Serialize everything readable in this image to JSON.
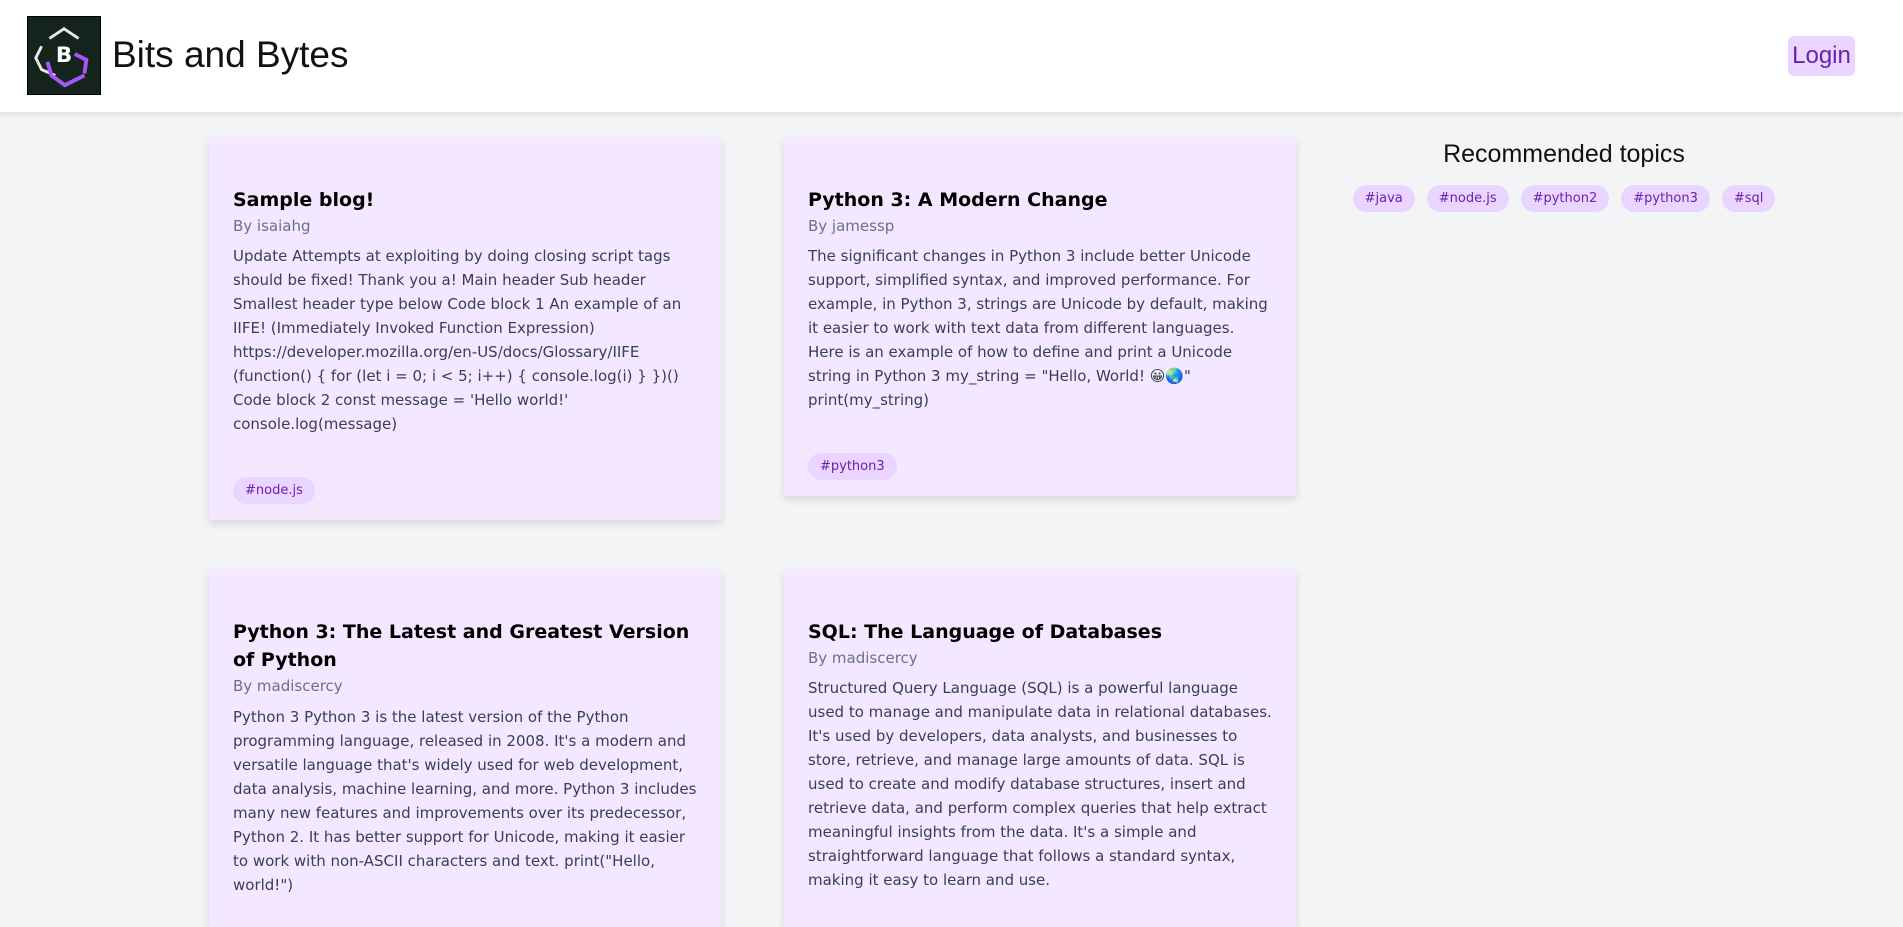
{
  "header": {
    "site_title": "Bits and Bytes",
    "login_label": "Login",
    "logo_letter": "B",
    "logo_icon": "bits-and-bytes-logo"
  },
  "posts": [
    {
      "title": "Sample blog!",
      "author": "By isaiahg",
      "body": "Update Attempts at exploiting by doing closing script tags should be fixed! Thank you a! Main header Sub header Smallest header type below Code block 1 An example of an IIFE! (Immediately Invoked Function Expression) https://developer.mozilla.org/en-US/docs/Glossary/IIFE (function() { for (let i = 0; i < 5; i++) { console.log(i) } })() Code block 2 const message = 'Hello world!' console.log(message)",
      "tags": [
        "#node.js"
      ]
    },
    {
      "title": "Python 3: A Modern Change",
      "author": "By jamessp",
      "body": "The significant changes in Python 3 include better Unicode support, simplified syntax, and improved performance. For example, in Python 3, strings are Unicode by default, making it easier to work with text data from different languages. Here is an example of how to define and print a Unicode string in Python 3 my_string = \"Hello, World! 😀🌏\" print(my_string)",
      "tags": [
        "#python3"
      ]
    },
    {
      "title": "Python 3: The Latest and Greatest Version of Python",
      "author": "By madiscercy",
      "body": "Python 3 Python 3 is the latest version of the Python programming language, released in 2008. It's a modern and versatile language that's widely used for web development, data analysis, machine learning, and more. Python 3 includes many new features and improvements over its predecessor, Python 2. It has better support for Unicode, making it easier to work with non-ASCII characters and text. print(\"Hello, world!\")",
      "tags": []
    },
    {
      "title": "SQL: The Language of Databases",
      "author": "By madiscercy",
      "body": "Structured Query Language (SQL) is a powerful language used to manage and manipulate data in relational databases. It's used by developers, data analysts, and businesses to store, retrieve, and manage large amounts of data. SQL is used to create and modify database structures, insert and retrieve data, and perform complex queries that help extract meaningful insights from the data. It's a simple and straightforward language that follows a standard syntax, making it easy to learn and use.",
      "tags": []
    }
  ],
  "recommended": {
    "title": "Recommended topics",
    "tags": [
      "#java",
      "#node.js",
      "#python2",
      "#python3",
      "#sql"
    ]
  },
  "colors": {
    "card_bg": "#f3e8ff",
    "tag_bg": "#e9d5ff",
    "tag_text": "#6b21a8",
    "page_bg": "#f3f4f6"
  }
}
